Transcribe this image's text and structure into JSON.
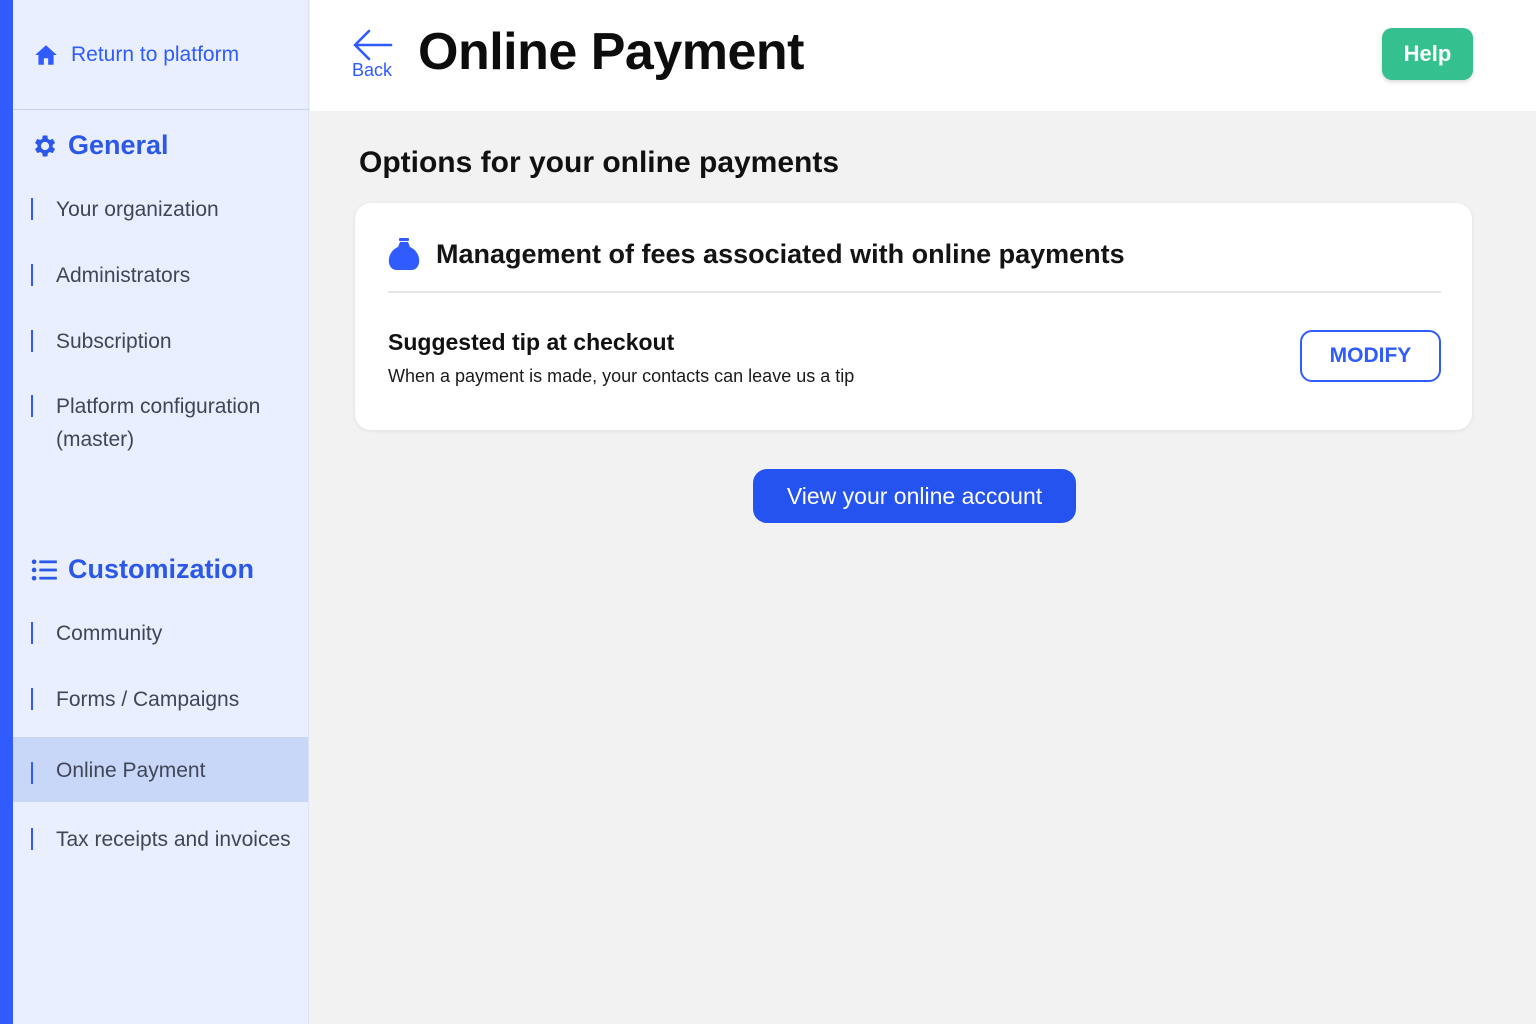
{
  "sidebar": {
    "return_label": "Return to platform",
    "return_icon": "home-icon",
    "general": {
      "title": "General",
      "icon": "gear-icon",
      "items": [
        {
          "label": "Your organization"
        },
        {
          "label": "Administrators"
        },
        {
          "label": "Subscription"
        },
        {
          "label": "Platform configuration",
          "label2": "(master)"
        }
      ]
    },
    "customization": {
      "title": "Customization",
      "icon": "list-icon",
      "items": [
        {
          "label": "Community"
        },
        {
          "label": "Forms / Campaigns"
        },
        {
          "label": "Online Payment",
          "active": true
        },
        {
          "label": "Tax receipts and invoices"
        }
      ]
    }
  },
  "header": {
    "back_label": "Back",
    "title": "Online Payment",
    "help_label": "Help"
  },
  "main": {
    "section_heading": "Options for your online payments",
    "card": {
      "icon": "money-bag-icon",
      "title": "Management of fees associated with online payments",
      "tip_title": "Suggested tip at checkout",
      "tip_description": "When a payment is made, your contacts can leave us a tip",
      "modify_label": "MODIFY"
    },
    "view_account_label": "View your online account"
  },
  "colors": {
    "accent": "#2f5bff",
    "help_green": "#34c18f",
    "sidebar_bg": "#e9efff",
    "active_item_bg": "#c8d6f8"
  }
}
